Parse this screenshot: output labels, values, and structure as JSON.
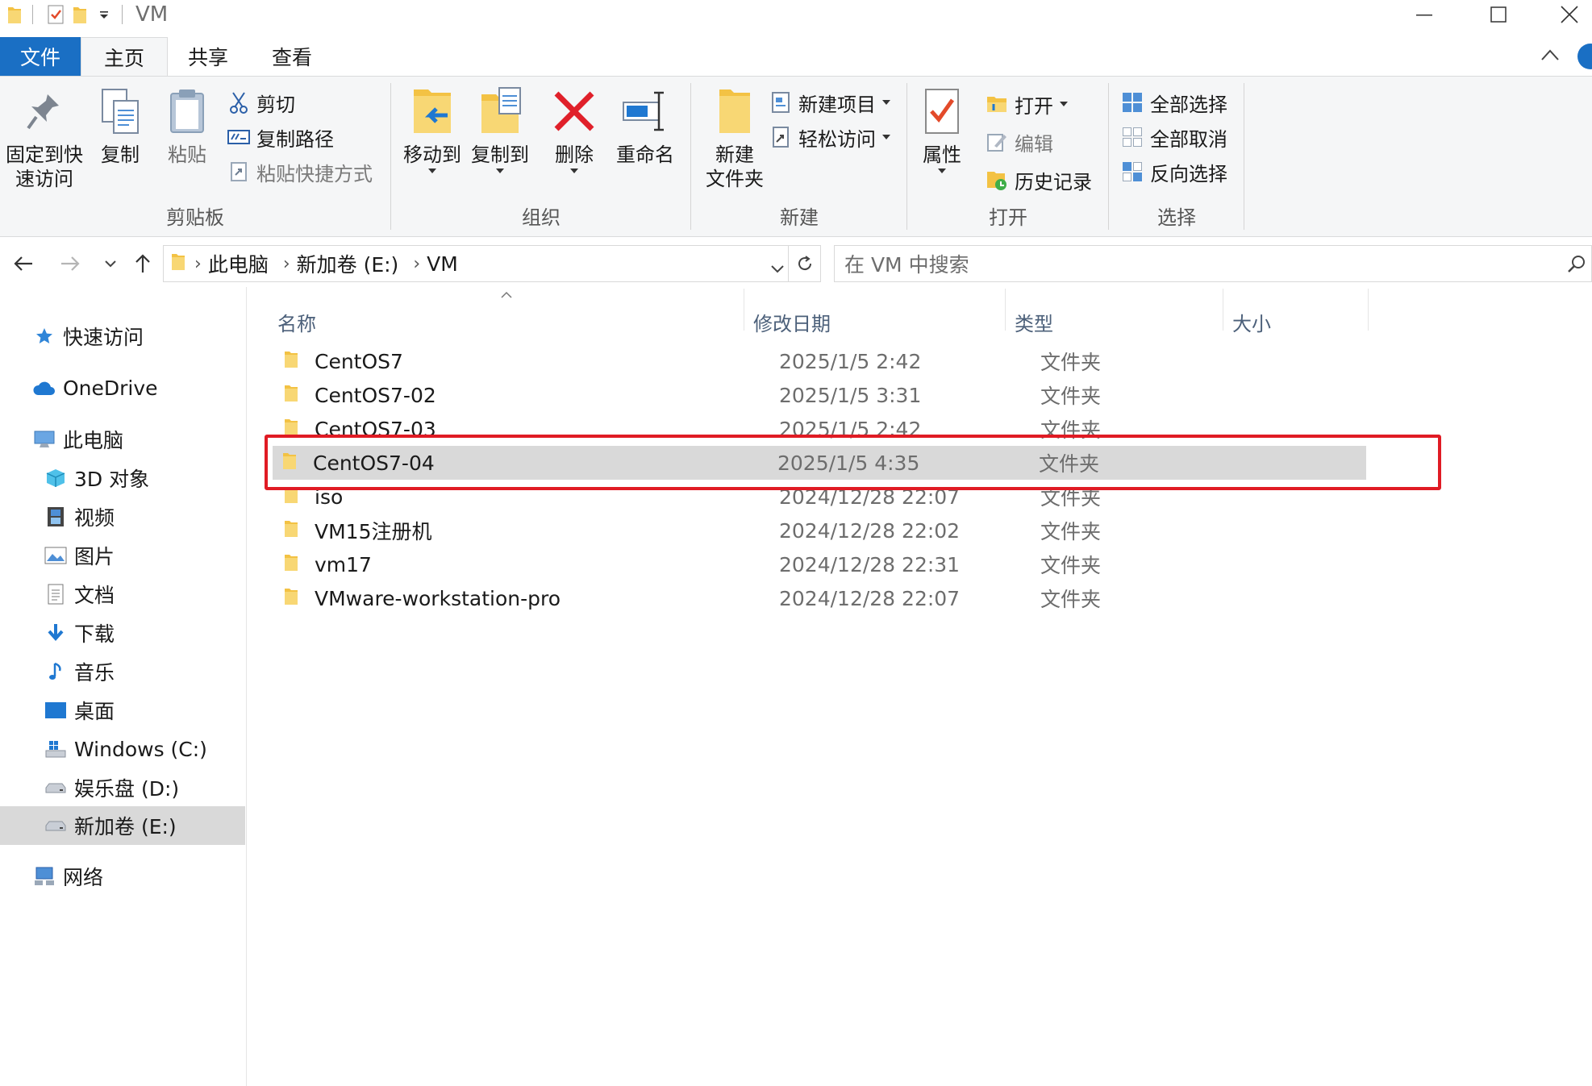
{
  "window": {
    "title": "VM"
  },
  "tabs": {
    "file": "文件",
    "home": "主页",
    "share": "共享",
    "view": "查看"
  },
  "ribbon": {
    "clipboard": {
      "label": "剪贴板",
      "pin_line1": "固定到快",
      "pin_line2": "速访问",
      "copy": "复制",
      "paste": "粘贴",
      "cut": "剪切",
      "copy_path": "复制路径",
      "paste_shortcut": "粘贴快捷方式"
    },
    "organize": {
      "label": "组织",
      "move_to": "移动到",
      "copy_to": "复制到",
      "delete": "删除",
      "rename": "重命名"
    },
    "new": {
      "label": "新建",
      "new_folder_line1": "新建",
      "new_folder_line2": "文件夹",
      "new_item": "新建项目",
      "easy_access": "轻松访问"
    },
    "open": {
      "label": "打开",
      "properties": "属性",
      "open": "打开",
      "edit": "编辑",
      "history": "历史记录"
    },
    "select": {
      "label": "选择",
      "select_all": "全部选择",
      "select_none": "全部取消",
      "invert": "反向选择"
    }
  },
  "address": {
    "crumbs": [
      "此电脑",
      "新加卷 (E:)",
      "VM"
    ],
    "search_placeholder": "在 VM 中搜索"
  },
  "nav": [
    {
      "label": "快速访问",
      "icon": "star-icon"
    },
    {
      "label": "OneDrive",
      "icon": "cloud-icon"
    },
    {
      "label": "此电脑",
      "icon": "computer-icon"
    },
    {
      "label": "3D 对象",
      "icon": "cube-icon"
    },
    {
      "label": "视频",
      "icon": "film-icon"
    },
    {
      "label": "图片",
      "icon": "picture-icon"
    },
    {
      "label": "文档",
      "icon": "document-icon"
    },
    {
      "label": "下载",
      "icon": "download-icon"
    },
    {
      "label": "音乐",
      "icon": "music-icon"
    },
    {
      "label": "桌面",
      "icon": "desktop-icon"
    },
    {
      "label": "Windows (C:)",
      "icon": "windows-drive-icon"
    },
    {
      "label": "娱乐盘 (D:)",
      "icon": "drive-icon"
    },
    {
      "label": "新加卷 (E:)",
      "icon": "drive-icon"
    },
    {
      "label": "网络",
      "icon": "network-icon"
    }
  ],
  "columns": {
    "name": "名称",
    "date": "修改日期",
    "type": "类型",
    "size": "大小"
  },
  "files": [
    {
      "name": "CentOS7",
      "date": "2025/1/5 2:42",
      "type": "文件夹"
    },
    {
      "name": "CentOS7-02",
      "date": "2025/1/5 3:31",
      "type": "文件夹"
    },
    {
      "name": "CentOS7-03",
      "date": "2025/1/5 2:42",
      "type": "文件夹"
    },
    {
      "name": "CentOS7-04",
      "date": "2025/1/5 4:35",
      "type": "文件夹"
    },
    {
      "name": "iso",
      "date": "2024/12/28 22:07",
      "type": "文件夹"
    },
    {
      "name": "VM15注册机",
      "date": "2024/12/28 22:02",
      "type": "文件夹"
    },
    {
      "name": "vm17",
      "date": "2024/12/28 22:31",
      "type": "文件夹"
    },
    {
      "name": "VMware-workstation-pro",
      "date": "2024/12/28 22:07",
      "type": "文件夹"
    }
  ],
  "selected_file_index": 3,
  "colors": {
    "accent": "#1a6fc4",
    "folder": "#f3c244",
    "highlight": "#e01b24",
    "selection": "#d9d9d9"
  }
}
